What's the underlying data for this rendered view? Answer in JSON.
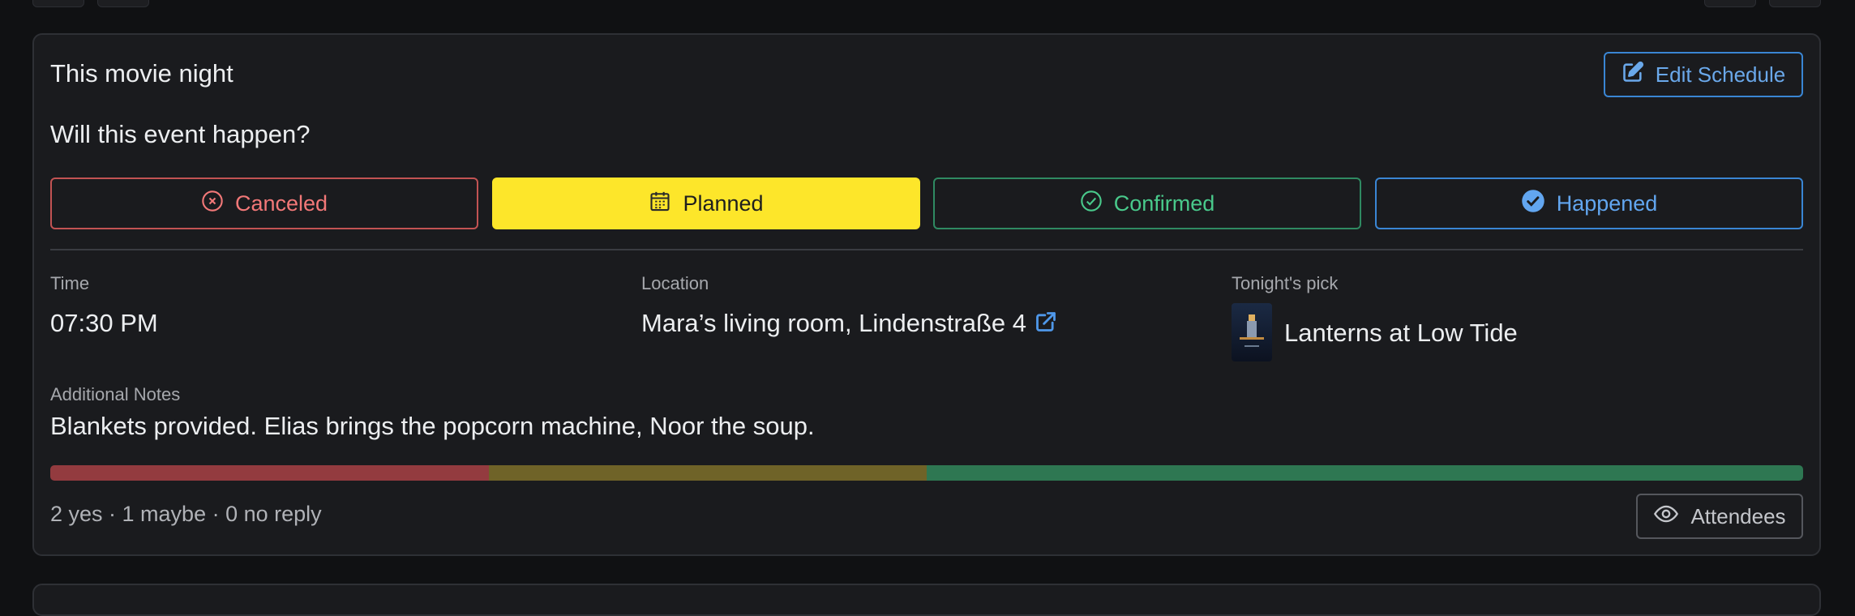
{
  "event": {
    "title": "This movie night",
    "edit_label": "Edit Schedule",
    "question": "Will this event happen?"
  },
  "status": {
    "selected": "Planned",
    "options": [
      "Canceled",
      "Planned",
      "Confirmed",
      "Happened"
    ]
  },
  "details": {
    "time_label": "Time",
    "time_value": "07:30 PM",
    "location_label": "Location",
    "location_value": "Mara’s living room, Lindenstraße 4",
    "pick_label": "Tonight's pick",
    "pick_value": "Lanterns at Low Tide",
    "notes_label": "Additional Notes",
    "notes_value": "Blankets provided. Elias brings the popcorn machine, Noor the soup."
  },
  "rsvp": {
    "bar_fractions": {
      "red": 0.25,
      "olive": 0.25,
      "green": 0.5
    },
    "summary": "2 yes · 1 maybe · 0 no reply",
    "attendees_label": "Attendees"
  },
  "colors": {
    "accent_blue": "#3a86d4",
    "planned_yellow": "#fde62a",
    "canceled_red": "#f27878",
    "confirmed_green": "#49c98b"
  },
  "icons": [
    "edit-icon",
    "x-circle-icon",
    "calendar-icon",
    "check-circle-icon",
    "check-filled-circle-icon",
    "external-link-icon",
    "eye-icon"
  ]
}
